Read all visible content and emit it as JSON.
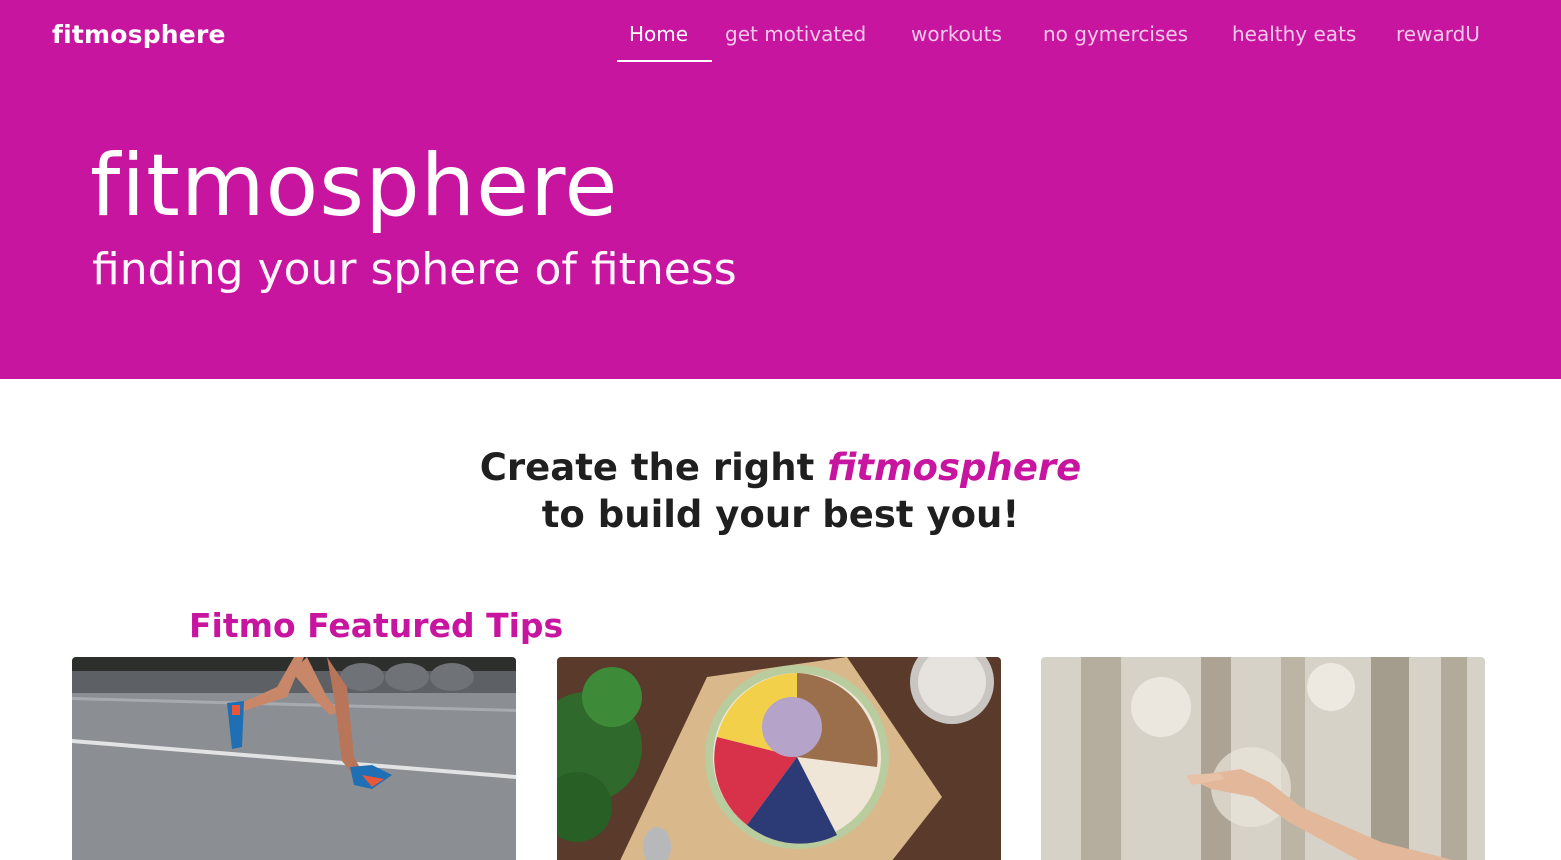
{
  "nav": {
    "brand": "fitmosphere",
    "links": [
      {
        "label": "Home",
        "active": true
      },
      {
        "label": "get motivated",
        "active": false
      },
      {
        "label": "workouts",
        "active": false
      },
      {
        "label": "no gymercises",
        "active": false
      },
      {
        "label": "healthy eats",
        "active": false
      },
      {
        "label": "rewardU",
        "active": false
      }
    ]
  },
  "hero": {
    "title": "fitmosphere",
    "subtitle": "finding your sphere of fitness"
  },
  "tagline": {
    "line1_prefix": "Create the right ",
    "line1_em": "fitmosphere",
    "line2": "to build your best you!"
  },
  "featured": {
    "title": "Fitmo Featured Tips",
    "cards": [
      {
        "image": "runner-photo"
      },
      {
        "image": "smoothie-bowl-photo"
      },
      {
        "image": "outdoor-stretch-photo"
      }
    ]
  },
  "colors": {
    "brand": "#c815a0",
    "text_dark": "#1f1f1f",
    "nav_inactive": "#f1c8e8"
  }
}
